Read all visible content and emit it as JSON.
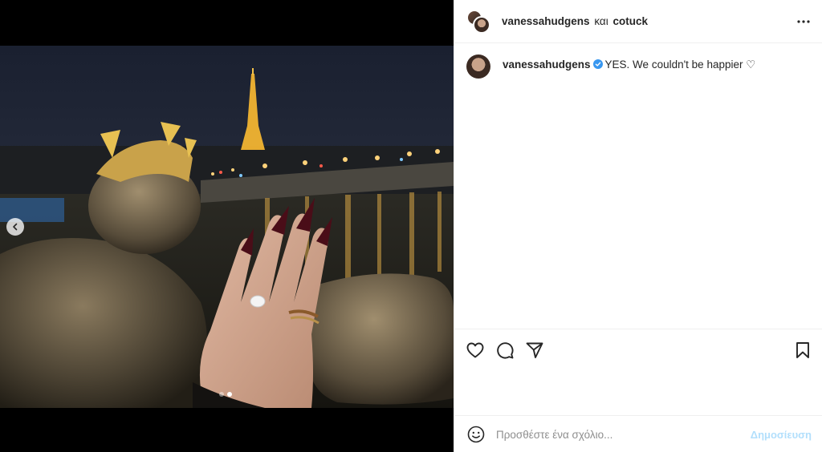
{
  "post": {
    "owner_primary": "vanessahudgens",
    "owner_conjunction": "και",
    "owner_secondary": "cotuck"
  },
  "caption": {
    "username": "vanessahudgens",
    "text": "YES. We couldn't be happier ♡"
  },
  "carousel": {
    "current_index": 2,
    "total": 2
  },
  "comment_box": {
    "placeholder": "Προσθέστε ένα σχόλιο...",
    "post_label": "Δημοσίευση"
  },
  "colors": {
    "verified": "#3897f0",
    "post_button_disabled": "#b2dffc",
    "divider": "#efefef"
  },
  "icons": {
    "more": "more-horizontal-icon",
    "like": "heart-outline-icon",
    "comment": "comment-bubble-icon",
    "share": "paper-plane-icon",
    "save": "bookmark-icon",
    "emoji": "smiley-icon",
    "prev": "chevron-left-icon",
    "verified": "verified-badge-icon"
  }
}
